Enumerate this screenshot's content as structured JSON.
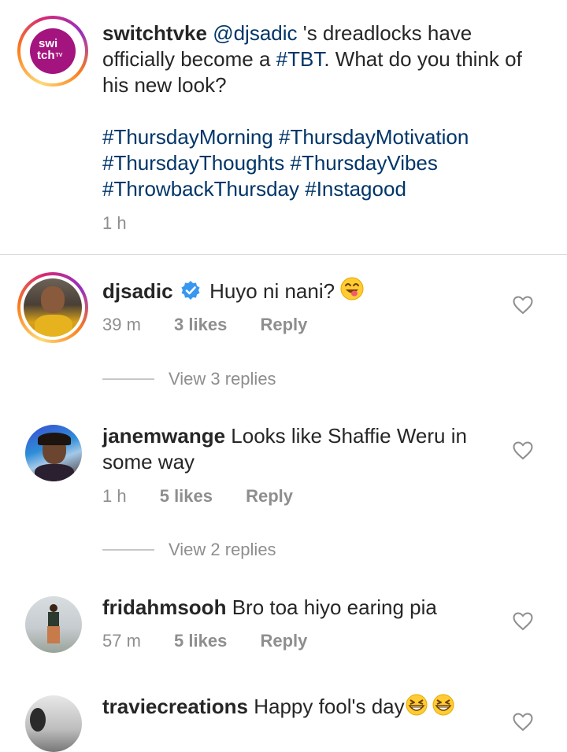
{
  "post": {
    "username": "switchtvke",
    "avatar_text_top": "swi",
    "avatar_text_bottom": "tch",
    "avatar_text_tv": "TV",
    "mention": "@djsadic",
    "text_1": " 's dreadlocks have officially become a ",
    "hashtag_tbt": "#TBT",
    "text_2": ". What do you think of his new look?",
    "hashtags_line1": [
      "#ThursdayMorning",
      "#ThursdayMotivation"
    ],
    "hashtags_line2": [
      "#ThursdayThoughts",
      "#ThursdayVibes"
    ],
    "hashtags_line3": [
      "#ThrowbackThursday",
      "#Instagood"
    ],
    "time": "1 h"
  },
  "comments": [
    {
      "username": "djsadic",
      "verified": true,
      "text": "Huyo ni nani?",
      "emoji": "smiling-face-with-tongue",
      "time": "39 m",
      "likes": "3 likes",
      "reply": "Reply",
      "view_replies": "View 3 replies"
    },
    {
      "username": "janemwange",
      "text": "Looks like Shaffie Weru in some way",
      "time": "1 h",
      "likes": "5 likes",
      "reply": "Reply",
      "view_replies": "View 2 replies"
    },
    {
      "username": "fridahmsooh",
      "text": "Bro toa hiyo earing pia",
      "time": "57 m",
      "likes": "5 likes",
      "reply": "Reply"
    },
    {
      "username": "traviecreations",
      "text": "Happy fool's day",
      "emoji": "grinning-squinting-face"
    }
  ],
  "colors": {
    "link": "#003569",
    "meta": "#8e8e8e",
    "verified": "#3897f0",
    "brand_purple": "#a4147e"
  }
}
